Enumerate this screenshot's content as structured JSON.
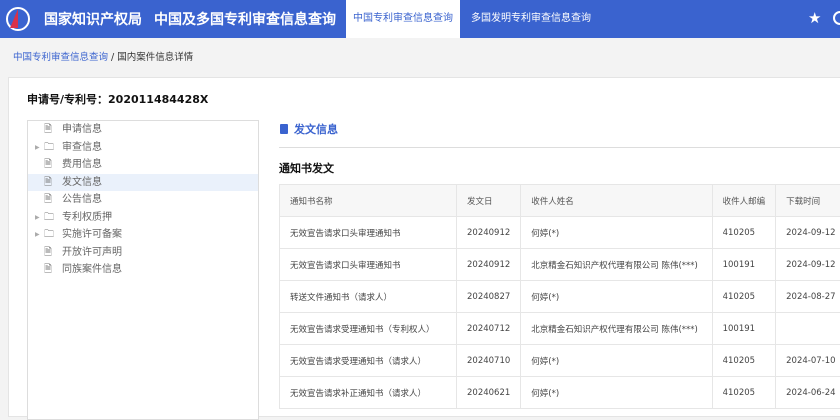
{
  "header": {
    "brand": "国家知识产权局",
    "system": "中国及多国专利审查信息查询",
    "tabs": [
      {
        "label": "中国专利审查信息查询"
      },
      {
        "label": "多国发明专利审查信息查询"
      }
    ]
  },
  "breadcrumb": {
    "link": "中国专利审查信息查询",
    "separator": "/",
    "current": "国内案件信息详情"
  },
  "application": {
    "label": "申请号/专利号：",
    "number": "202011484428X"
  },
  "tree": [
    {
      "label": "申请信息",
      "type": "file"
    },
    {
      "label": "审查信息",
      "type": "folder"
    },
    {
      "label": "费用信息",
      "type": "file"
    },
    {
      "label": "发文信息",
      "type": "file",
      "selected": true
    },
    {
      "label": "公告信息",
      "type": "file"
    },
    {
      "label": "专利权质押",
      "type": "folder"
    },
    {
      "label": "实施许可备案",
      "type": "folder"
    },
    {
      "label": "开放许可声明",
      "type": "file"
    },
    {
      "label": "同族案件信息",
      "type": "file"
    }
  ],
  "section": {
    "title": "发文信息",
    "subtitle": "通知书发文"
  },
  "table": {
    "columns": [
      "通知书名称",
      "发文日",
      "收件人姓名",
      "收件人邮编",
      "下载时间"
    ],
    "rows": [
      [
        "无效宣告请求口头审理通知书",
        "20240912",
        "何婷(*)",
        "410205",
        "2024-09-12"
      ],
      [
        "无效宣告请求口头审理通知书",
        "20240912",
        "北京精金石知识产权代理有限公司 陈伟(***)",
        "100191",
        "2024-09-12"
      ],
      [
        "转送文件通知书（请求人）",
        "20240827",
        "何婷(*)",
        "410205",
        "2024-08-27"
      ],
      [
        "无效宣告请求受理通知书（专利权人）",
        "20240712",
        "北京精金石知识产权代理有限公司 陈伟(***)",
        "100191",
        ""
      ],
      [
        "无效宣告请求受理通知书（请求人）",
        "20240710",
        "何婷(*)",
        "410205",
        "2024-07-10"
      ],
      [
        "无效宣告请求补正通知书（请求人）",
        "20240621",
        "何婷(*)",
        "410205",
        "2024-06-24"
      ]
    ]
  }
}
